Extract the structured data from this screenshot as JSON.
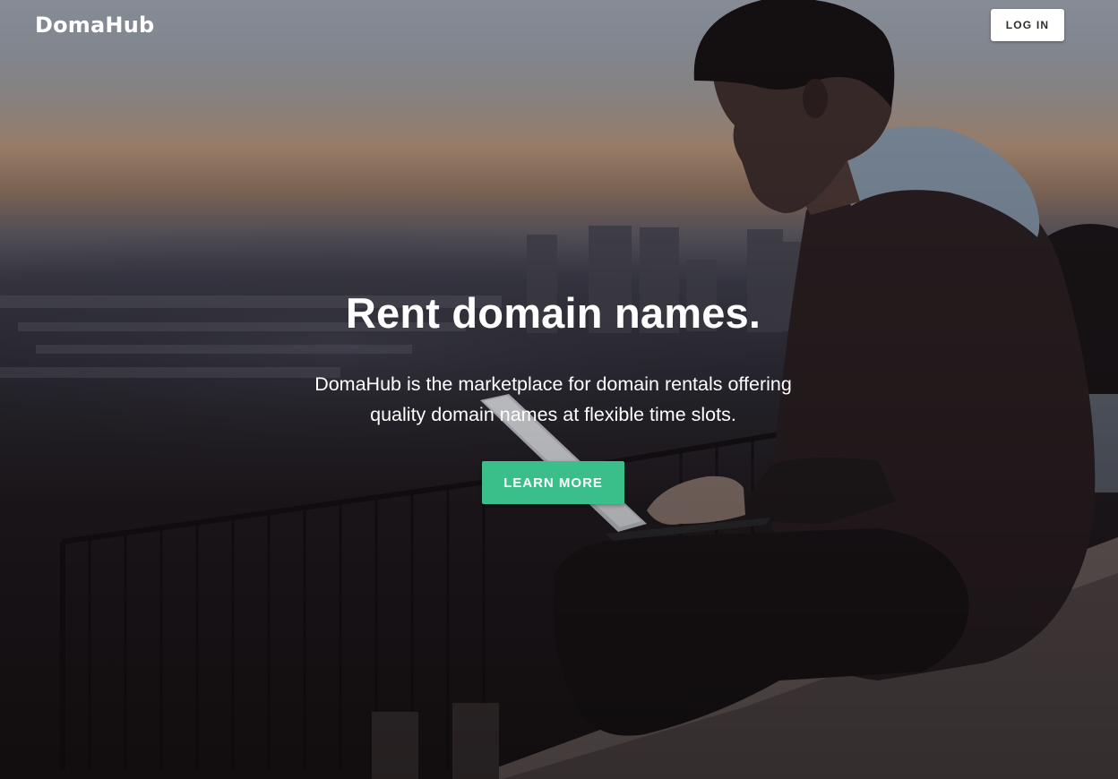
{
  "navbar": {
    "logo_text": "DomaHub",
    "login_label": "LOG IN"
  },
  "hero": {
    "title": "Rent domain names.",
    "subtitle": "DomaHub is the marketplace for domain rentals offering quality domain names at flexible time slots.",
    "cta_label": "LEARN MORE"
  },
  "colors": {
    "accent": "#3bbf8a",
    "login_bg": "#ffffff",
    "text": "#ffffff"
  },
  "background": {
    "description_icon": "photo-man-laptop-city-dusk"
  }
}
